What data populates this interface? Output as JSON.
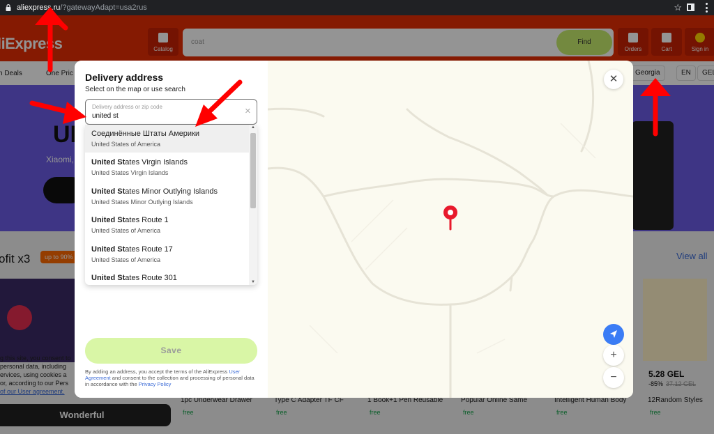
{
  "browser": {
    "url_host": "aliexpress.ru",
    "url_path": "/?gatewayAdapt=usa2rus"
  },
  "site": {
    "logo": "liExpress",
    "search_value": "coat",
    "find_label": "Find",
    "header_buttons": {
      "catalog": "Catalog",
      "orders": "Orders",
      "cart": "Cart",
      "signin": "Sign in"
    },
    "nav": {
      "deals": "n Deals",
      "one_price": "One Pric",
      "region": "Georgia",
      "lang": "EN",
      "currency": "GEL"
    },
    "banner": {
      "headline": "UP",
      "sub": "Xiaomi,"
    },
    "section_title": "ofit x3",
    "section_badge": "up to 90%",
    "view_all": "View all",
    "cookie_lines": [
      "g this site, you consent to",
      "personal data, including",
      "ervices, using cookies a",
      "or, according to our Pers",
      "of our User agreement."
    ],
    "cookie_button": "Wonderful",
    "products": [
      {
        "title": "1pc Underwear Drawer",
        "shipping": "free"
      },
      {
        "title": "Type C Adapter TF CF",
        "shipping": "free"
      },
      {
        "title": "1 Book+1 Pen Reusable",
        "shipping": "free"
      },
      {
        "title": "Popular Online Same",
        "shipping": "free"
      },
      {
        "title": "Intelligent Human Body",
        "shipping": "free"
      },
      {
        "title": "12Random Styles",
        "shipping": "free"
      }
    ],
    "featured_price": "5.28 GEL",
    "featured_discount": "-85%",
    "featured_old_price": "37.12 GEL"
  },
  "modal": {
    "title": "Delivery address",
    "subtitle": "Select on the map or use search",
    "field_placeholder": "Delivery address or zip code",
    "field_value": "united st",
    "suggestions": [
      {
        "bold": "",
        "rest": "Соединённые Штаты Америки",
        "sub": "United States of America"
      },
      {
        "bold": "United St",
        "rest": "ates Virgin Islands",
        "sub": "United States Virgin Islands"
      },
      {
        "bold": "United St",
        "rest": "ates Minor Outlying Islands",
        "sub": "United States Minor Outlying Islands"
      },
      {
        "bold": "United St",
        "rest": "ates Route 1",
        "sub": "United States of America"
      },
      {
        "bold": "United St",
        "rest": "ates Route 17",
        "sub": "United States of America"
      },
      {
        "bold": "United St",
        "rest": "ates Route 301",
        "sub": ""
      }
    ],
    "save_label": "Save",
    "terms_a": "By adding an address, you accept the terms of the AliExpress ",
    "terms_link1": "User Agreement",
    "terms_b": " and consent to the collection and processing of personal data in accordance with the ",
    "terms_link2": "Privacy Policy",
    "close_glyph": "✕",
    "zoom_in": "+",
    "zoom_out": "−"
  },
  "colors": {
    "brand_red": "#e62e04",
    "save_green": "#d9f6a6",
    "pin_red": "#e8192c",
    "geo_blue": "#3b7cf5",
    "arrow_red": "#ff0000"
  }
}
